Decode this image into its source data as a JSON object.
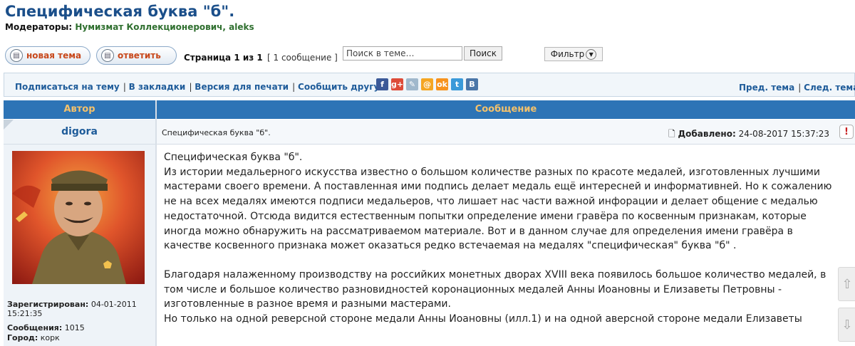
{
  "topic": {
    "title": "Специфическая буква \"б\".",
    "moderators_label": "Модераторы:",
    "moderators": "Нумизмат Коллекционерович, aleks"
  },
  "actions": {
    "new_topic": "новая тема",
    "reply": "ответить",
    "pager": "Страница 1 из 1",
    "msg_count": "[ 1 сообщение ]",
    "search_placeholder": "Поиск в теме…",
    "search_button": "Поиск",
    "filter": "Фильтр"
  },
  "toolbar": {
    "links": [
      "Подписаться на тему",
      "В закладки",
      "Версия для печати",
      "Сообщить другу"
    ],
    "prev_topic": "Пред. тема",
    "next_topic": "След. тема",
    "social_icons": [
      {
        "name": "facebook-icon",
        "glyph": "f",
        "color": "#3b5998"
      },
      {
        "name": "google-plus-icon",
        "glyph": "g+",
        "color": "#dd4b39"
      },
      {
        "name": "livejournal-icon",
        "glyph": "✎",
        "color": "#a0b8cc"
      },
      {
        "name": "mailru-icon",
        "glyph": "@",
        "color": "#f5a623"
      },
      {
        "name": "odnoklassniki-icon",
        "glyph": "ok",
        "color": "#f7931e"
      },
      {
        "name": "twitter-icon",
        "glyph": "t",
        "color": "#3a9ad9"
      },
      {
        "name": "vkontakte-icon",
        "glyph": "B",
        "color": "#4a76a8"
      }
    ]
  },
  "table": {
    "col_author": "Автор",
    "col_message": "Сообщение"
  },
  "post": {
    "author": "digora",
    "subject": "Специфическая буква \"б\".",
    "added_label": "Добавлено:",
    "added_date": "24-08-2017 15:37:23",
    "registered_label": "Зарегистрирован:",
    "registered_value": "04-01-2011 15:21:35",
    "posts_label": "Сообщения:",
    "posts_value": "1015",
    "city_label": "Город:",
    "city_value": "корк",
    "paragraphs": [
      "Специфическая буква \"б\".",
      "Из истории медальерного искусства известно о большом количестве разных по красоте медалей, изготовленных лучшими мастерами своего времени. А поставленная ими подпись делает медаль ещё интересней и информативней. Но к сожалению не на всех медалях имеются подписи медальеров, что лишает нас части важной инфорации и делает общение с медалью недостаточной. Отсюда видится естественным попытки определение имени гравёра по косвенным признакам, которые иногда можно обнаружить на рассматриваемом материале. Вот и в данном случае для определения имени гравёра в качестве косвенного признака может оказаться редко встечаемая на медалях \"специфическая\" буква \"б\" .",
      "Благодаря налаженному производству на российких монетных дворах XVIII века появилось большое количество медалей, в том числе и большое количество разновидностей коронационных медалей Анны Иоановны и Елизаветы Петровны - изготовленные в разное время и разными мастерами.",
      "Но только на одной реверсной стороне медали Анны Иоановны (илл.1) и на одной аверсной стороне медали Елизаветы"
    ]
  }
}
